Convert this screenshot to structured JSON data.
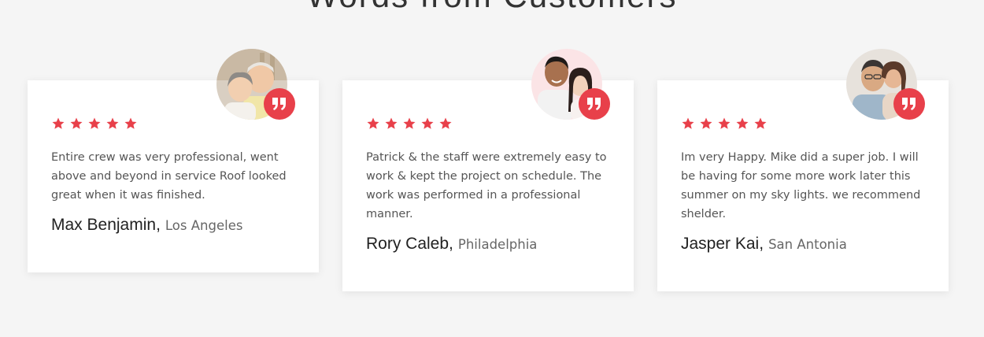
{
  "section": {
    "title": "Words from Customers"
  },
  "colors": {
    "accent": "#e8404a",
    "star": "#e8404a",
    "background": "#f5f5f5",
    "card": "#ffffff"
  },
  "testimonials": [
    {
      "rating": 5,
      "text": "Entire crew was very professional, went above and beyond in service Roof looked great when it was finished.",
      "name": "Max Benjamin",
      "separator": ",",
      "city": "Los Angeles",
      "avatar": "elderly-couple-photo",
      "quote_icon": "quote-icon"
    },
    {
      "rating": 5,
      "text": "Patrick & the staff were extremely easy to work & kept the project on schedule. The work was performed in a professional manner.",
      "name": "Rory Caleb",
      "separator": ",",
      "city": "Philadelphia",
      "avatar": "young-couple-photo",
      "quote_icon": "quote-icon"
    },
    {
      "rating": 5,
      "text": "Im very Happy. Mike did a super job. I will be having for some more work later this summer on my sky lights. we recommend shelder.",
      "name": "Jasper Kai",
      "separator": ",",
      "city": "San Antonia",
      "avatar": "middle-aged-couple-photo",
      "quote_icon": "quote-icon"
    }
  ]
}
